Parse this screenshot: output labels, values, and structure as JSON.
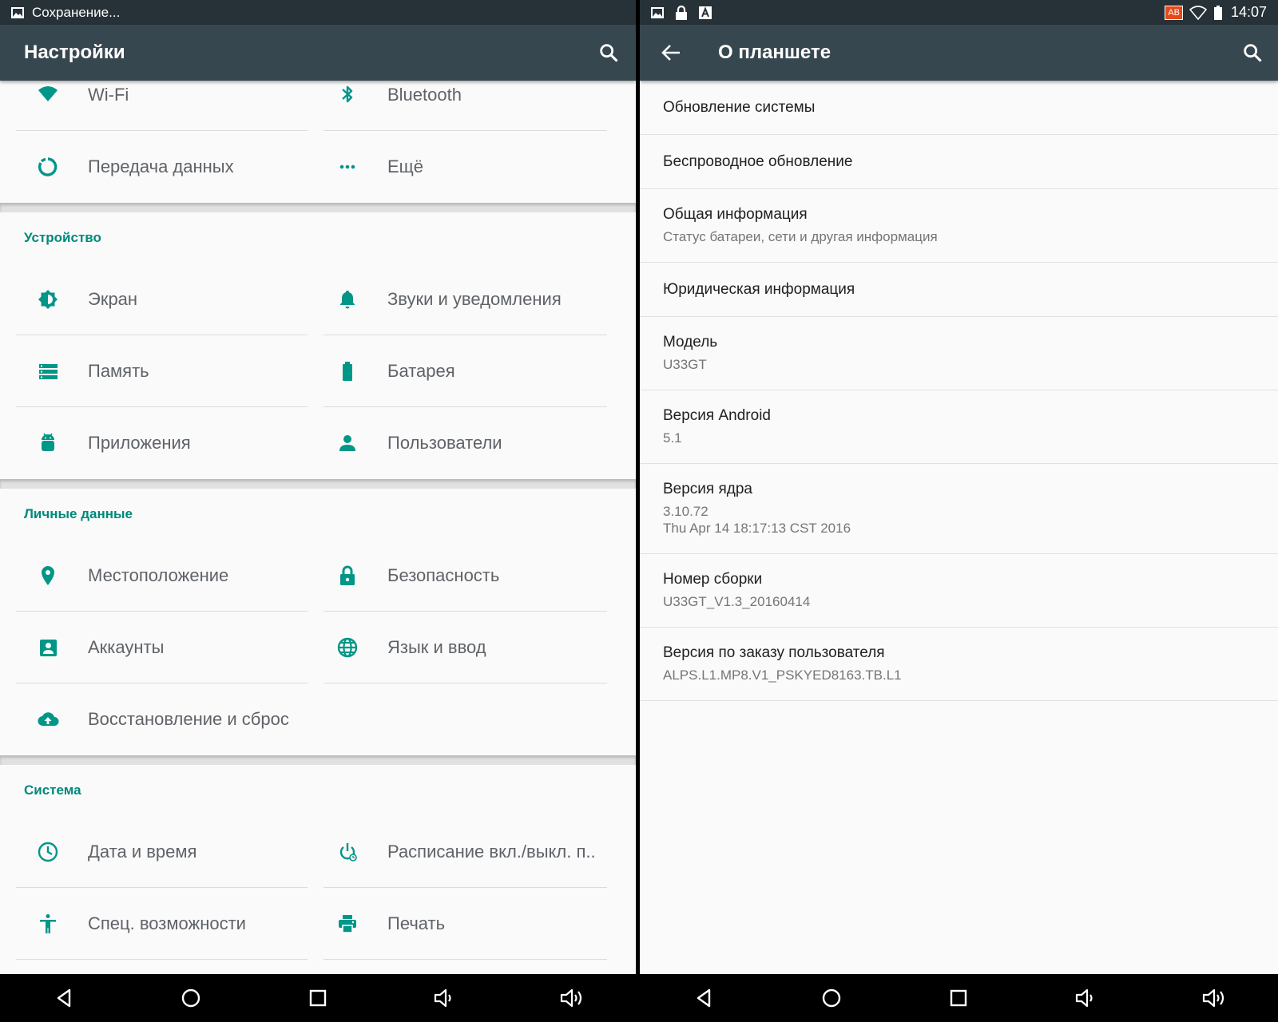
{
  "left": {
    "status": {
      "text": "Сохранение..."
    },
    "appbar": {
      "title": "Настройки"
    },
    "top_rows": [
      [
        {
          "icon": "wifi-icon",
          "label": "Wi-Fi"
        },
        {
          "icon": "bluetooth-icon",
          "label": "Bluetooth"
        }
      ],
      [
        {
          "icon": "data-usage-icon",
          "label": "Передача данных"
        },
        {
          "icon": "more-horiz-icon",
          "label": "Ещё"
        }
      ]
    ],
    "sections": [
      {
        "title": "Устройство",
        "rows": [
          [
            {
              "icon": "brightness-icon",
              "label": "Экран"
            },
            {
              "icon": "bell-icon",
              "label": "Звуки и уведомления"
            }
          ],
          [
            {
              "icon": "storage-icon",
              "label": "Память"
            },
            {
              "icon": "battery-icon",
              "label": "Батарея"
            }
          ],
          [
            {
              "icon": "android-icon",
              "label": "Приложения"
            },
            {
              "icon": "person-icon",
              "label": "Пользователи"
            }
          ]
        ]
      },
      {
        "title": "Личные данные",
        "rows": [
          [
            {
              "icon": "location-icon",
              "label": "Местоположение"
            },
            {
              "icon": "lock-icon",
              "label": "Безопасность"
            }
          ],
          [
            {
              "icon": "account-box-icon",
              "label": "Аккаунты"
            },
            {
              "icon": "globe-icon",
              "label": "Язык и ввод"
            }
          ],
          [
            {
              "icon": "cloud-upload-icon",
              "label": "Восстановление и сброс"
            }
          ]
        ]
      },
      {
        "title": "Система",
        "rows": [
          [
            {
              "icon": "clock-icon",
              "label": "Дата и время"
            },
            {
              "icon": "power-schedule-icon",
              "label": "Расписание вкл./выкл. п.."
            }
          ],
          [
            {
              "icon": "accessibility-icon",
              "label": "Спец. возможности"
            },
            {
              "icon": "print-icon",
              "label": "Печать"
            }
          ]
        ]
      }
    ]
  },
  "right": {
    "status": {
      "time": "14:07",
      "badge": "AB"
    },
    "appbar": {
      "title": "О планшете"
    },
    "items": [
      {
        "title": "Обновление системы",
        "sub": []
      },
      {
        "title": "Беспроводное обновление",
        "sub": []
      },
      {
        "title": "Общая информация",
        "sub": [
          "Статус батареи, сети и другая информация"
        ]
      },
      {
        "title": "Юридическая информация",
        "sub": []
      },
      {
        "title": "Модель",
        "sub": [
          "U33GT"
        ]
      },
      {
        "title": "Версия Android",
        "sub": [
          "5.1"
        ]
      },
      {
        "title": "Версия ядра",
        "sub": [
          "3.10.72",
          "Thu Apr 14 18:17:13 CST 2016"
        ]
      },
      {
        "title": "Номер сборки",
        "sub": [
          "U33GT_V1.3_20160414"
        ]
      },
      {
        "title": "Версия по заказу пользователя",
        "sub": [
          "ALPS.L1.MP8.V1_PSKYED8163.TB.L1"
        ]
      }
    ]
  },
  "colors": {
    "accent": "#009688",
    "appbar": "#37474f",
    "statusbar": "#263238"
  }
}
